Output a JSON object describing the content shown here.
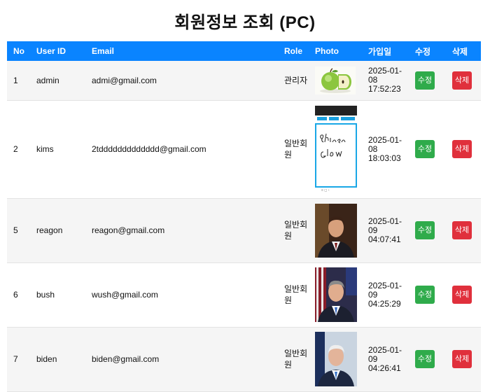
{
  "page": {
    "title": "회원정보 조회 (PC)"
  },
  "table": {
    "headers": [
      "No",
      "User ID",
      "Email",
      "Role",
      "Photo",
      "가입일",
      "수정",
      "삭제"
    ],
    "edit_label": "수정",
    "delete_label": "삭제",
    "rows": [
      {
        "no": "1",
        "user_id": "admin",
        "email": "admi@gmail.com",
        "role": "관리자",
        "photo": "green-apple-photo",
        "date": "2025-01-08 17:52:23"
      },
      {
        "no": "2",
        "user_id": "kims",
        "email": "2tddddddddddddd@gmail.com",
        "role": "일반회원",
        "photo": "handwriting-app-screenshot",
        "date": "2025-01-08 18:03:03"
      },
      {
        "no": "5",
        "user_id": "reagon",
        "email": "reagon@gmail.com",
        "role": "일반회원",
        "photo": "portrait-photo",
        "date": "2025-01-09 04:07:41"
      },
      {
        "no": "6",
        "user_id": "bush",
        "email": "wush@gmail.com",
        "role": "일반회원",
        "photo": "portrait-photo",
        "date": "2025-01-09 04:25:29"
      },
      {
        "no": "7",
        "user_id": "biden",
        "email": "biden@gmail.com",
        "role": "일반회원",
        "photo": "portrait-photo",
        "date": "2025-01-09 04:26:41"
      }
    ]
  },
  "colors": {
    "header_bg": "#0a84ff",
    "edit_button": "#2fab4b",
    "delete_button": "#e0303c"
  }
}
